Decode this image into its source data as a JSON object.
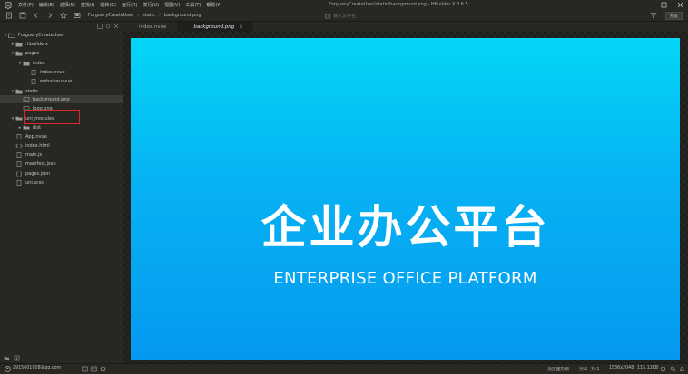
{
  "menubar": {
    "items": [
      "文件(F)",
      "编辑(E)",
      "选择(S)",
      "查找(I)",
      "跳转(G)",
      "运行(R)",
      "发行(U)",
      "视图(V)",
      "工具(T)",
      "帮助(Y)"
    ],
    "window_title": "ForgueryCreateUser/static/background.png - HBuilder X 3.6.5"
  },
  "toolbar": {
    "breadcrumb": [
      "ForgueryCreateUser",
      "static",
      "background.png"
    ],
    "search_placeholder": "输入文件名",
    "preview_label": "预览"
  },
  "sidebar": {
    "tree": [
      {
        "label": "ForgueryCreateUser",
        "indent": 0,
        "arrow": "▾",
        "icon": "project-icon"
      },
      {
        "label": ".hbuilderx",
        "indent": 1,
        "arrow": "▸",
        "icon": "folder-icon"
      },
      {
        "label": "pages",
        "indent": 1,
        "arrow": "▾",
        "icon": "folder-icon"
      },
      {
        "label": "index",
        "indent": 2,
        "arrow": "▾",
        "icon": "folder-icon"
      },
      {
        "label": "index.nvue",
        "indent": 3,
        "arrow": "",
        "icon": "file-icon"
      },
      {
        "label": "webview.nvue",
        "indent": 3,
        "arrow": "",
        "icon": "file-icon"
      },
      {
        "label": "static",
        "indent": 1,
        "arrow": "▾",
        "icon": "folder-icon"
      },
      {
        "label": "background.png",
        "indent": 2,
        "arrow": "",
        "icon": "image-icon"
      },
      {
        "label": "logo.png",
        "indent": 2,
        "arrow": "",
        "icon": "image-icon"
      },
      {
        "label": "uni_modules",
        "indent": 1,
        "arrow": "▾",
        "icon": "folder-icon"
      },
      {
        "label": "dist",
        "indent": 2,
        "arrow": "▸",
        "icon": "folder-icon"
      },
      {
        "label": "App.nvue",
        "indent": 1,
        "arrow": "",
        "icon": "file-icon"
      },
      {
        "label": "index.html",
        "indent": 1,
        "arrow": "",
        "icon": "code-icon"
      },
      {
        "label": "main.js",
        "indent": 1,
        "arrow": "",
        "icon": "file-icon"
      },
      {
        "label": "manifest.json",
        "indent": 1,
        "arrow": "",
        "icon": "file-icon"
      },
      {
        "label": "pages.json",
        "indent": 1,
        "arrow": "",
        "icon": "json-icon"
      },
      {
        "label": "uni.scss",
        "indent": 1,
        "arrow": "",
        "icon": "file-icon"
      }
    ]
  },
  "tabs": [
    {
      "label": "index.nvue",
      "active": false
    },
    {
      "label": "background.png",
      "active": true,
      "close": "×"
    }
  ],
  "preview": {
    "title": "企业办公平台",
    "subtitle": "ENTERPRISE OFFICE PLATFORM"
  },
  "statusbar": {
    "user": "2915601908@qq.com",
    "mode": "通览图形频",
    "line": "行:1",
    "col": "列:1",
    "dimensions": "1536x2048",
    "size": "115.12KB"
  },
  "colors": {
    "accent_red": "#e0272c",
    "gradient_top": "#04d6f7",
    "gradient_bottom": "#0599ef"
  }
}
